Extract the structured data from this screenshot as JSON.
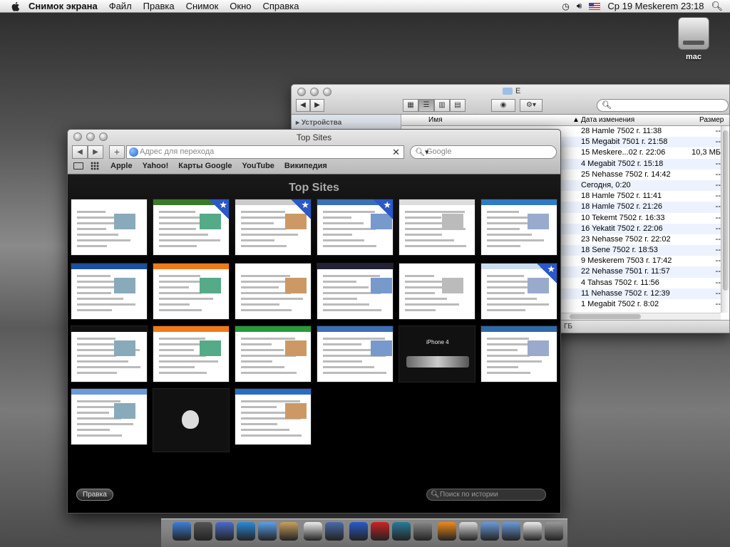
{
  "menubar": {
    "app_name": "Снимок экрана",
    "items": [
      "Файл",
      "Правка",
      "Снимок",
      "Окно",
      "Справка"
    ],
    "date_time": "Ср 19 Meskerem  23:18"
  },
  "desktop": {
    "disk_label": "mac"
  },
  "finder": {
    "title": "E",
    "sidebar_header": "Устройства",
    "col_name": "Имя",
    "col_date": "Дата изменения",
    "col_size": "Размер",
    "rows": [
      {
        "date": "28 Hamle 7502 г. 11:38",
        "size": "--"
      },
      {
        "date": "15 Megabit 7501 г. 21:58",
        "size": "--"
      },
      {
        "date": "15 Meskere...02 г. 22:06",
        "size": "10,3 МБ"
      },
      {
        "date": "4 Megabit 7502 г. 15:18",
        "size": "--"
      },
      {
        "date": "25 Nehasse 7502 г. 14:42",
        "size": "--"
      },
      {
        "date": "Сегодня, 0:20",
        "size": "--"
      },
      {
        "date": "18 Hamle 7502 г. 11:41",
        "size": "--"
      },
      {
        "date": "18 Hamle 7502 г. 21:26",
        "size": "--"
      },
      {
        "date": "10 Tekemt 7502 г. 16:33",
        "size": "--"
      },
      {
        "date": "16 Yekatit 7502 г. 22:06",
        "size": "--"
      },
      {
        "date": "23 Nehasse 7502 г. 22:02",
        "size": "--"
      },
      {
        "date": "18 Sene 7502 г. 18:53",
        "size": "--"
      },
      {
        "date": "9 Meskerem 7503 г. 17:42",
        "size": "--"
      },
      {
        "date": "22 Nehasse 7501 г. 11:57",
        "size": "--"
      },
      {
        "date": "4 Tahsas 7502 г. 11:56",
        "size": "--"
      },
      {
        "date": "11 Nehasse 7502 г. 12:39",
        "size": "--"
      },
      {
        "date": "1 Megabit 7502 г. 8:02",
        "size": "--"
      }
    ],
    "status": "ГБ"
  },
  "safari": {
    "title": "Top Sites",
    "address_placeholder": "Адрес для перехода",
    "search_placeholder": "Google",
    "bookmarks": [
      "Apple",
      "Yahoo!",
      "Карты Google",
      "YouTube",
      "Википедия"
    ],
    "top_sites_heading": "Top Sites",
    "edit_button": "Правка",
    "history_search_placeholder": "Поиск по истории",
    "iphone_thumb_text": "iPhone 4"
  },
  "colors": {
    "selection_star": "#2a58c8",
    "row_stripe": "#edf3fe"
  }
}
